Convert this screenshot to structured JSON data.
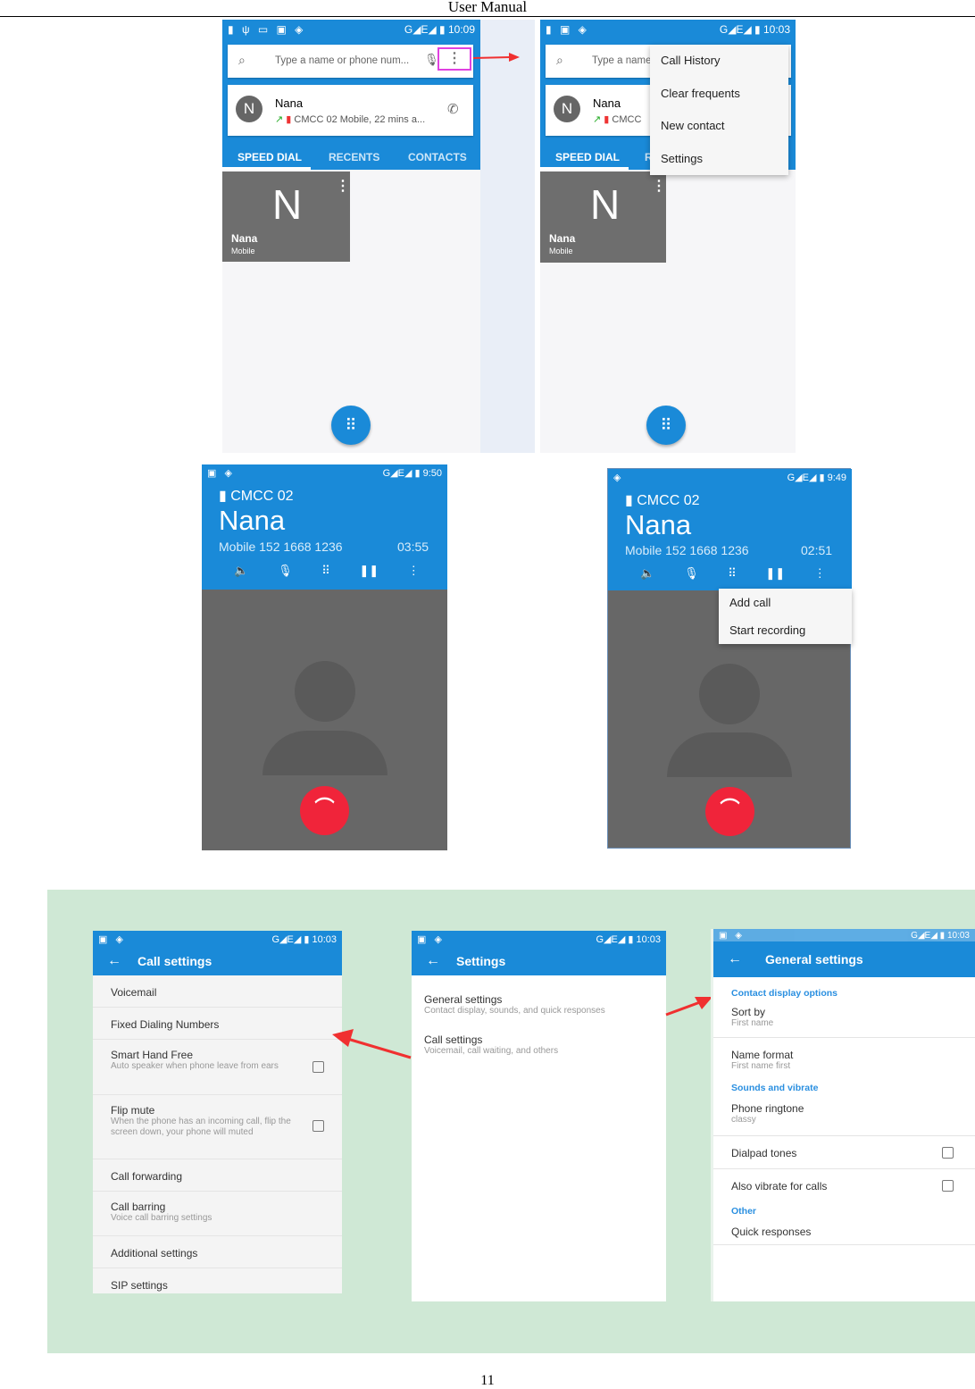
{
  "header": "User    Manual",
  "page_number": "11",
  "colors": {
    "primary": "#1a8ad8",
    "end_call": "#f0243a",
    "highlight": "#e040e0",
    "arrow": "#f03030",
    "section_bg": "#cfe8d5",
    "section_header": "#2a8fe0"
  },
  "dialer1": {
    "time": "10:09",
    "search_placeholder": "Type a name or phone num...",
    "contact_name": "Nana",
    "contact_detail": "CMCC 02 Mobile, 22 mins a...",
    "avatar_letter": "N",
    "tabs": [
      "SPEED DIAL",
      "RECENTS",
      "CONTACTS"
    ],
    "tile_letter": "N",
    "tile_name": "Nana",
    "tile_type": "Mobile"
  },
  "dialer2": {
    "time": "10:03",
    "search_placeholder": "Type a name",
    "contact_name": "Nana",
    "contact_detail": "CMCC",
    "avatar_letter": "N",
    "tab": "SPEED DIAL",
    "tab2_partial": "R",
    "menu": [
      "Call History",
      "Clear frequents",
      "New contact",
      "Settings"
    ],
    "tile_letter": "N",
    "tile_name": "Nana",
    "tile_type": "Mobile"
  },
  "call1": {
    "time": "9:50",
    "carrier": "CMCC 02",
    "name": "Nana",
    "number": "Mobile 152 1668 1236",
    "duration": "03:55"
  },
  "call2": {
    "time": "9:49",
    "carrier": "CMCC 02",
    "name": "Nana",
    "number": "Mobile 152 1668 1236",
    "duration": "02:51",
    "menu": [
      "Add call",
      "Start recording"
    ]
  },
  "call_settings": {
    "time": "10:03",
    "title": "Call settings",
    "items": [
      {
        "title": "Voicemail"
      },
      {
        "title": "Fixed Dialing Numbers"
      },
      {
        "title": "Smart Hand Free",
        "sub": "Auto speaker when phone leave from ears",
        "checkbox": false
      },
      {
        "title": "Flip mute",
        "sub": "When the phone has an incoming call, flip the screen down, your phone will muted",
        "checkbox": false
      },
      {
        "title": "Call forwarding"
      },
      {
        "title": "Call barring",
        "sub": "Voice call barring settings"
      },
      {
        "title": "Additional settings"
      },
      {
        "title": "SIP settings"
      }
    ]
  },
  "settings": {
    "time": "10:03",
    "title": "Settings",
    "items": [
      {
        "title": "General settings",
        "sub": "Contact display, sounds, and quick responses"
      },
      {
        "title": "Call settings",
        "sub": "Voicemail, call waiting, and others"
      }
    ]
  },
  "general_settings": {
    "time": "10:03",
    "title": "General settings",
    "sec1": "Contact display options",
    "sort_by": "Sort by",
    "sort_val": "First name",
    "name_format": "Name format",
    "name_val": "First name first",
    "sec2": "Sounds and vibrate",
    "ringtone": "Phone ringtone",
    "ringtone_val": "classy",
    "dialpad": "Dialpad tones",
    "vibrate": "Also vibrate for calls",
    "sec3": "Other",
    "quick": "Quick responses"
  },
  "status_icons": "G◢E◢"
}
